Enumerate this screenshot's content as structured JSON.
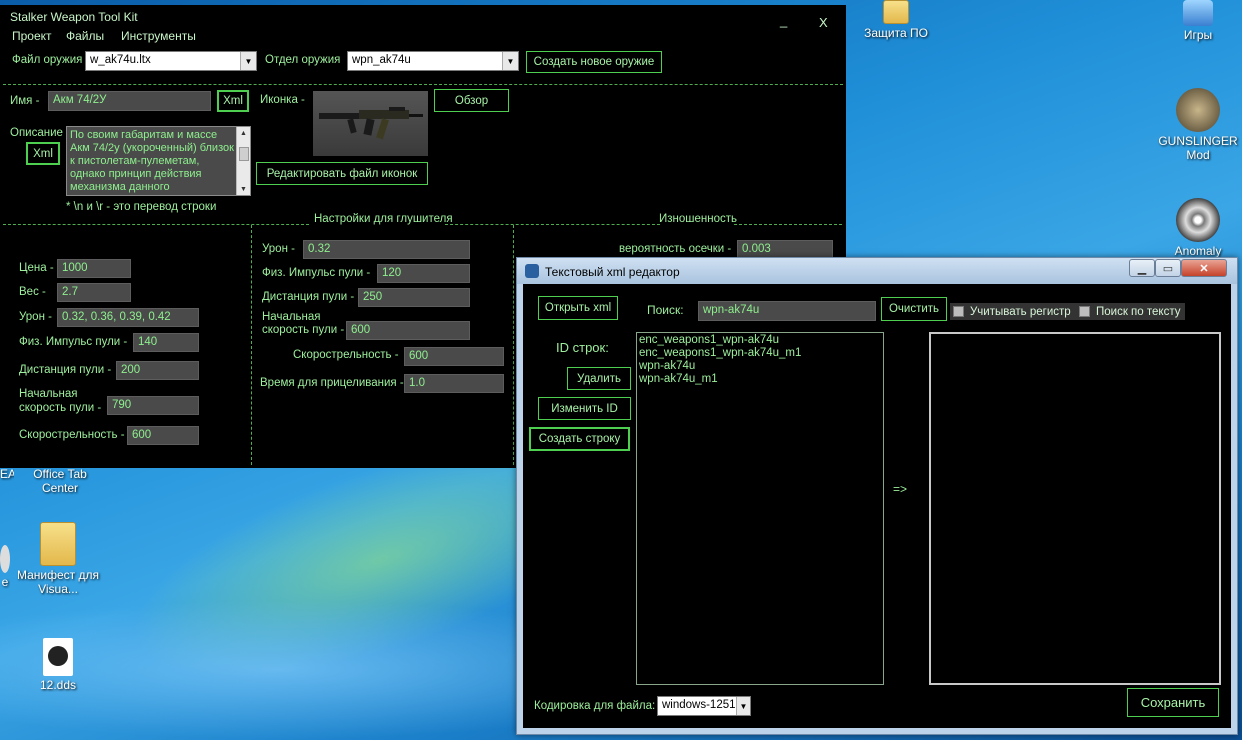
{
  "desktop": {
    "icons": [
      {
        "id": "zashita",
        "label": "Защита ПО"
      },
      {
        "id": "igry",
        "label": "Игры"
      },
      {
        "id": "gunslinger",
        "label": "GUNSLINGER Mod"
      },
      {
        "id": "anomaly",
        "label": "Anomaly"
      },
      {
        "id": "office-tab",
        "label": "Office Tab Center"
      },
      {
        "id": "manifest",
        "label": "Манифест для Visua..."
      },
      {
        "id": "dds",
        "label": "12.dds"
      },
      {
        "id": "ea",
        "label": "EA"
      },
      {
        "id": "partial-e",
        "label": "е"
      }
    ]
  },
  "tool": {
    "title": "Stalker Weapon Tool Kit",
    "minimize": "_",
    "close": "X",
    "menu": [
      "Проект",
      "Файлы",
      "Инструменты"
    ],
    "weapon_file_label": "Файл оружия",
    "weapon_file_value": "w_ak74u.ltx",
    "weapon_section_label": "Отдел оружия",
    "weapon_section_value": "wpn_ak74u",
    "create_weapon_btn": "Создать новое оружие",
    "name_label": "Имя",
    "name_value": "Акм 74/2У",
    "xml_btn": "Xml",
    "icon_label": "Иконка",
    "browse_btn": "Обзор",
    "desc_label": "Описание",
    "desc_xml_btn": "Xml",
    "desc_value": "По своим габаритам и массе Акм 74/2у (укороченный) близок к пистолетам-пулеметам, однако принцип действия механизма данного",
    "edit_icons_btn": "Редактировать файл иконок",
    "newline_hint": "* \\n и \\r - это перевод строки",
    "silencer_header": "Настройки для глушителя",
    "wear_header": "Изношенность",
    "left_params": [
      {
        "label": "Цена",
        "value": "1000"
      },
      {
        "label": "Вес",
        "value": "2.7"
      },
      {
        "label": "Урон",
        "value": "0.32, 0.36, 0.39, 0.42"
      },
      {
        "label": "Физ. Импульс пули",
        "value": "140"
      },
      {
        "label": "Дистанция пули",
        "value": "200"
      },
      {
        "label": "Начальная скорость пули",
        "value": "790"
      },
      {
        "label": "Скорострельность",
        "value": "600"
      }
    ],
    "mid_params": [
      {
        "label": "Урон",
        "value": "0.32"
      },
      {
        "label": "Физ. Импульс пули",
        "value": "120"
      },
      {
        "label": "Дистанция пули",
        "value": "250"
      },
      {
        "label": "Начальная скорость пули",
        "value": "600"
      },
      {
        "label": "Скорострельность",
        "value": "600"
      },
      {
        "label": "Время для прицеливания",
        "value": "1.0"
      }
    ],
    "misfire_label": "вероятность осечки",
    "misfire_value": "0.003"
  },
  "xml_editor": {
    "title": "Текстовый xml редактор",
    "open_xml_btn": "Открыть xml",
    "search_label": "Поиск:",
    "search_value": "wpn-ak74u",
    "clear_btn": "Очистить",
    "case_checkbox": "Учитывать регистр",
    "text_search_checkbox": "Поиск по тексту",
    "id_rows_label": "ID строк:",
    "delete_btn": "Удалить",
    "change_id_btn": "Изменить ID",
    "create_row_btn": "Создать строку",
    "id_list": [
      "enc_weapons1_wpn-ak74u",
      "enc_weapons1_wpn-ak74u_m1",
      "wpn-ak74u",
      "wpn-ak74u_m1"
    ],
    "arrow": "=>",
    "encoding_label": "Кодировка для файла:",
    "encoding_value": "windows-1251",
    "save_btn": "Сохранить"
  }
}
